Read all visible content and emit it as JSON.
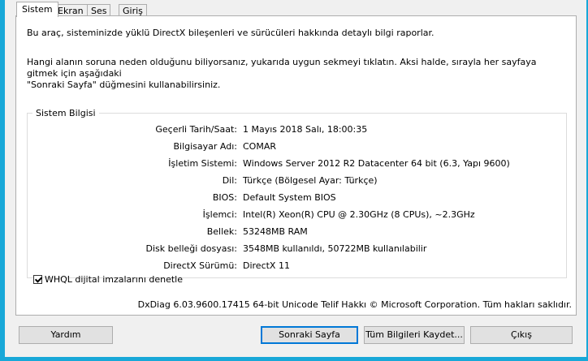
{
  "tabs": [
    "Sistem",
    "Ekran",
    "Ses",
    "Giriş"
  ],
  "intro": "Bu araç, sisteminizde yüklü DirectX bileşenleri ve sürücüleri hakkında detaylı bilgi raporlar.",
  "hint_line1": "Hangi alanın soruna neden olduğunu biliyorsanız, yukarıda uygun sekmeyi tıklatın.  Aksi halde, sırayla her sayfaya gitmek için aşağıdaki",
  "hint_line2": "\"Sonraki Sayfa\" düğmesini kullanabilirsiniz.",
  "group_title": "Sistem Bilgisi",
  "system_info": [
    {
      "label": "Geçerli Tarih/Saat:",
      "value": "1 Mayıs 2018 Salı, 18:00:35"
    },
    {
      "label": "Bilgisayar Adı:",
      "value": "COMAR"
    },
    {
      "label": "İşletim Sistemi:",
      "value": "Windows Server 2012 R2 Datacenter 64 bit (6.3, Yapı 9600)"
    },
    {
      "label": "Dil:",
      "value": "Türkçe (Bölgesel Ayar: Türkçe)"
    },
    {
      "label": "BIOS:",
      "value": "Default System BIOS"
    },
    {
      "label": "İşlemci:",
      "value": "Intel(R) Xeon(R) CPU @ 2.30GHz (8 CPUs), ~2.3GHz"
    },
    {
      "label": "Bellek:",
      "value": "53248MB RAM"
    },
    {
      "label": "Disk belleği dosyası:",
      "value": "3548MB kullanıldı, 50722MB kullanılabilir"
    },
    {
      "label": "DirectX Sürümü:",
      "value": "DirectX 11"
    }
  ],
  "whql_label": "WHQL dijital imzalarını denetle",
  "whql_checked": true,
  "footer": "DxDiag 6.03.9600.17415 64-bit Unicode  Telif Hakkı © Microsoft Corporation. Tüm hakları saklıdır.",
  "buttons": {
    "help": "Yardım",
    "next": "Sonraki Sayfa",
    "save_all": "Tüm Bilgileri Kaydet...",
    "exit": "Çıkış"
  }
}
